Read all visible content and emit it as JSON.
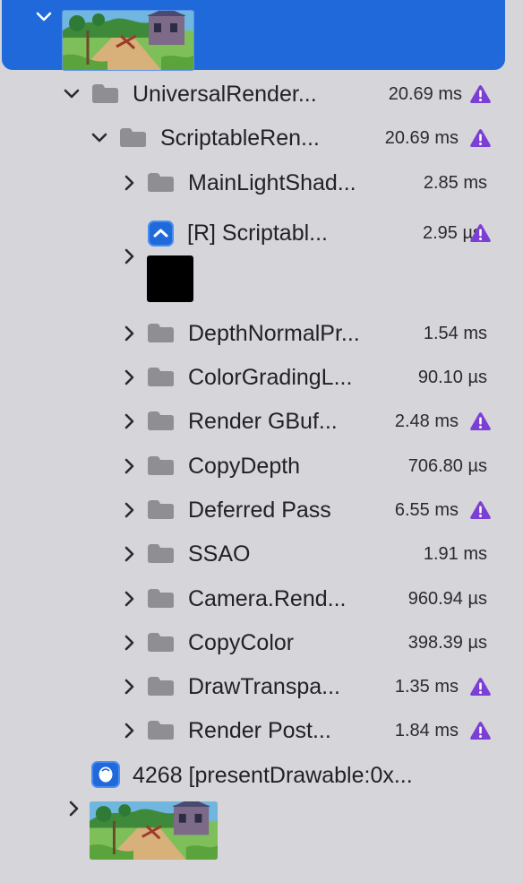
{
  "colors": {
    "selection": "#1f69db",
    "background": "#d6d5da",
    "folder": "#8e8e93",
    "warning": "#7b3fd6"
  },
  "tree": {
    "root_thumbnail": {
      "icon": "scene-thumbnail-icon"
    },
    "universal": {
      "name": "UniversalRender...",
      "time": "20.69 ms",
      "warning": true
    },
    "scriptable": {
      "name": "ScriptableRen...",
      "time": "20.69 ms",
      "warning": true
    },
    "children": [
      {
        "name": "MainLightShad...",
        "time": "2.85 ms",
        "warning": false
      },
      {
        "name": "[R] Scriptabl...",
        "time": "2.95 µs",
        "warning": true
      },
      {
        "name": "DepthNormalPr...",
        "time": "1.54 ms",
        "warning": false
      },
      {
        "name": "ColorGradingL...",
        "time": "90.10 µs",
        "warning": false
      },
      {
        "name": "Render GBuf...",
        "time": "2.48 ms",
        "warning": true
      },
      {
        "name": "CopyDepth",
        "time": "706.80 µs",
        "warning": false
      },
      {
        "name": "Deferred Pass",
        "time": "6.55 ms",
        "warning": true
      },
      {
        "name": "SSAO",
        "time": "1.91 ms",
        "warning": false
      },
      {
        "name": "Camera.Rend...",
        "time": "960.94 µs",
        "warning": false
      },
      {
        "name": "CopyColor",
        "time": "398.39 µs",
        "warning": false
      },
      {
        "name": "DrawTranspa...",
        "time": "1.35 ms",
        "warning": true
      },
      {
        "name": "Render Post...",
        "time": "1.84 ms",
        "warning": true
      }
    ],
    "present": {
      "name": "4268 [presentDrawable:0x..."
    }
  }
}
